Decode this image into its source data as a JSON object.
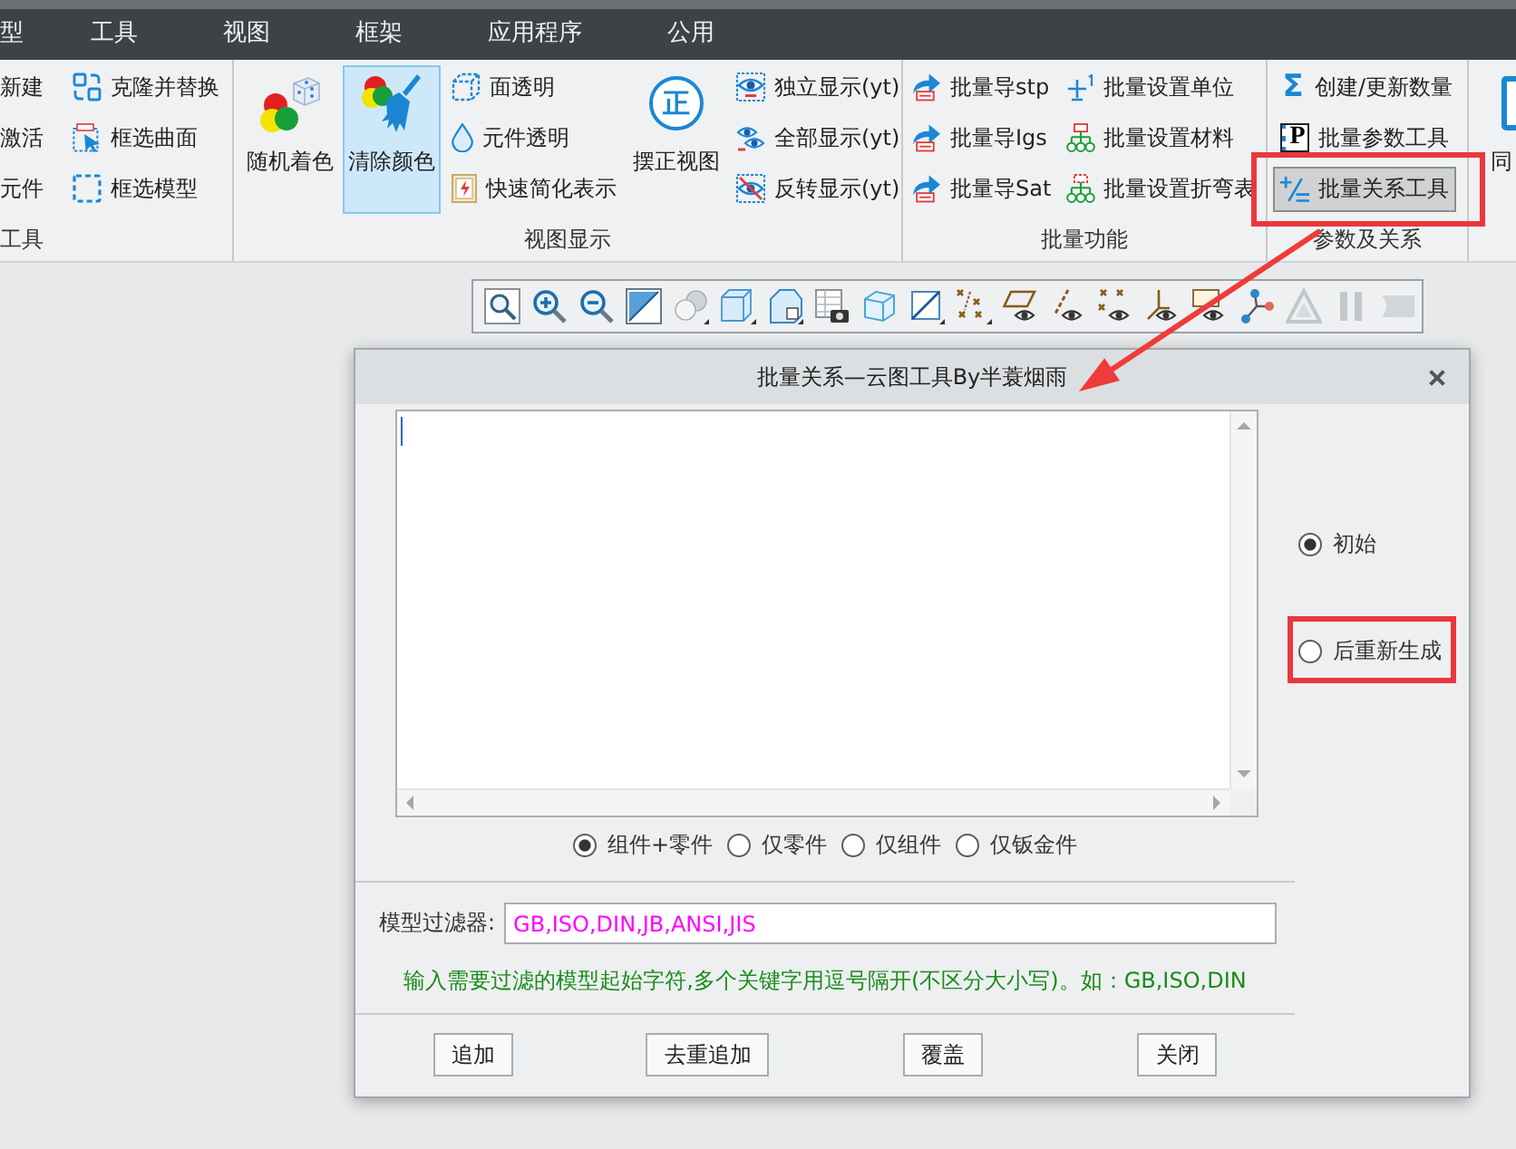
{
  "menu_bar": {
    "items": [
      "型",
      "工具",
      "视图",
      "框架",
      "应用程序",
      "公用"
    ]
  },
  "ribbon": {
    "groups": [
      {
        "label": "工具",
        "columns": [
          {
            "kind": "small",
            "items": [
              {
                "label": "新建",
                "selected": false,
                "annotated": false
              },
              {
                "label": "激活",
                "selected": false,
                "annotated": false
              },
              {
                "label": "元件",
                "selected": false,
                "annotated": false
              }
            ]
          },
          {
            "kind": "small",
            "items": [
              {
                "label": "克隆并替换",
                "selected": false,
                "annotated": false
              },
              {
                "label": "框选曲面",
                "selected": false,
                "annotated": false
              },
              {
                "label": "框选模型",
                "selected": false,
                "annotated": false
              }
            ]
          }
        ]
      },
      {
        "label": "视图显示",
        "columns": [
          {
            "kind": "large",
            "items": [
              {
                "label": "随机着色",
                "selected": false,
                "annotated": false
              }
            ]
          },
          {
            "kind": "large",
            "items": [
              {
                "label": "清除颜色",
                "selected": true,
                "annotated": false
              }
            ]
          },
          {
            "kind": "small",
            "items": [
              {
                "label": "面透明",
                "selected": false,
                "annotated": false
              },
              {
                "label": "元件透明",
                "selected": false,
                "annotated": false
              },
              {
                "label": "快速简化表示",
                "selected": false,
                "annotated": false
              }
            ]
          },
          {
            "kind": "large",
            "items": [
              {
                "label": "摆正视图",
                "glyph": "正",
                "selected": false,
                "annotated": false
              }
            ]
          },
          {
            "kind": "small",
            "items": [
              {
                "label": "独立显示(yt)",
                "selected": false,
                "annotated": false
              },
              {
                "label": "全部显示(yt)",
                "selected": false,
                "annotated": false
              },
              {
                "label": "反转显示(yt)",
                "selected": false,
                "annotated": false
              }
            ]
          }
        ]
      },
      {
        "label": "批量功能",
        "columns": [
          {
            "kind": "small",
            "items": [
              {
                "label": "批量导stp",
                "selected": false,
                "annotated": false
              },
              {
                "label": "批量导Igs",
                "selected": false,
                "annotated": false
              },
              {
                "label": "批量导Sat",
                "selected": false,
                "annotated": false
              }
            ]
          },
          {
            "kind": "small",
            "items": [
              {
                "label": "批量设置单位",
                "selected": false,
                "annotated": false
              },
              {
                "label": "批量设置材料",
                "selected": false,
                "annotated": false
              },
              {
                "label": "批量设置折弯表",
                "selected": false,
                "annotated": false
              }
            ]
          }
        ]
      },
      {
        "label": "参数及关系",
        "columns": [
          {
            "kind": "small",
            "items": [
              {
                "label": "创建/更新数量",
                "glyph": "Σ",
                "selected": false,
                "annotated": false
              },
              {
                "label": "批量参数工具",
                "glyph": "P",
                "selected": false,
                "annotated": false
              },
              {
                "label": "批量关系工具",
                "selected": true,
                "annotated": true
              }
            ]
          }
        ]
      },
      {
        "columns": [
          {
            "kind": "large",
            "items": [
              {
                "label": "同",
                "selected": false,
                "annotated": false
              }
            ]
          }
        ]
      }
    ]
  },
  "view_toolbar": {
    "tools": [
      {
        "disabled": false
      },
      {
        "disabled": false
      },
      {
        "disabled": false
      },
      {
        "disabled": false
      },
      {
        "disabled": false
      },
      {
        "disabled": false
      },
      {
        "disabled": false
      },
      {
        "disabled": false
      },
      {
        "disabled": false
      },
      {
        "disabled": false
      },
      {
        "disabled": false
      },
      {
        "disabled": false
      },
      {
        "disabled": false
      },
      {
        "disabled": false
      },
      {
        "disabled": false
      },
      {
        "disabled": false
      },
      {
        "disabled": false
      },
      {
        "disabled": true
      },
      {
        "disabled": true
      },
      {
        "disabled": true
      }
    ]
  },
  "dialog": {
    "title": "批量关系—云图工具By半蓑烟雨",
    "regen_options": [
      {
        "label": "初始",
        "selected": true,
        "annotated": false
      },
      {
        "label": "后重新生成",
        "selected": false,
        "annotated": true
      }
    ],
    "scope_options": [
      {
        "label": "组件+零件",
        "selected": true
      },
      {
        "label": "仅零件",
        "selected": false
      },
      {
        "label": "仅组件",
        "selected": false
      },
      {
        "label": "仅钣金件",
        "selected": false
      }
    ],
    "filter": {
      "label": "模型过滤器:",
      "value": "GB,ISO,DIN,JB,ANSI,JIS"
    },
    "hint": "输入需要过滤的模型起始字符,多个关键字用逗号隔开(不区分大小写)。如：GB,ISO,DIN",
    "buttons": [
      "追加",
      "去重追加",
      "覆盖",
      "关闭"
    ]
  }
}
